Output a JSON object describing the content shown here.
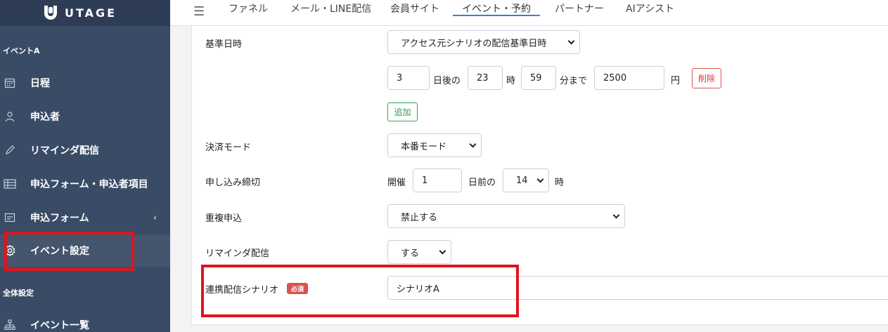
{
  "brand": {
    "name": "UTAGE"
  },
  "sidebar": {
    "section_event": "イベントA",
    "section_global": "全体設定",
    "items": [
      {
        "label": "日程",
        "icon": "calendar-icon"
      },
      {
        "label": "申込者",
        "icon": "user-icon"
      },
      {
        "label": "リマインダ配信",
        "icon": "pencil-icon"
      },
      {
        "label": "申込フォーム・申込者項目",
        "icon": "table-icon"
      },
      {
        "label": "申込フォーム",
        "icon": "form-icon",
        "chevron": "‹"
      },
      {
        "label": "イベント設定",
        "icon": "gear-icon",
        "active": true
      },
      {
        "label": "イベント一覧",
        "icon": "sitemap-icon"
      }
    ]
  },
  "topnav": {
    "menu_icon": "☰",
    "tabs": [
      {
        "label": "ファネル"
      },
      {
        "label": "メール・LINE配信"
      },
      {
        "label": "会員サイト"
      },
      {
        "label": "イベント・予約",
        "active": true
      },
      {
        "label": "パートナー"
      },
      {
        "label": "AIアシスト"
      }
    ]
  },
  "form": {
    "base_date": {
      "label": "基準日時",
      "select_value": "アクセス元シナリオの配信基準日時",
      "days": "3",
      "days_suffix": "日後の",
      "hour": "23",
      "hour_suffix": "時",
      "minute": "59",
      "minute_suffix": "分まで",
      "price": "2500",
      "price_suffix": "円",
      "delete_label": "削除",
      "add_label": "追加"
    },
    "payment_mode": {
      "label": "決済モード",
      "value": "本番モード"
    },
    "deadline": {
      "label": "申し込み締切",
      "prefix": "開催",
      "days": "1",
      "days_suffix": "日前の",
      "hour": "14",
      "hour_suffix": "時"
    },
    "duplicate": {
      "label": "重複申込",
      "value": "禁止する"
    },
    "reminder": {
      "label": "リマインダ配信",
      "value": "する"
    },
    "linked_scenario": {
      "label": "連携配信シナリオ",
      "required_badge": "必須",
      "value": "シナリオA"
    }
  },
  "colors": {
    "sidebar_bg": "#3a4b66",
    "accent": "#3d7dd8",
    "highlight": "#e0141c"
  }
}
